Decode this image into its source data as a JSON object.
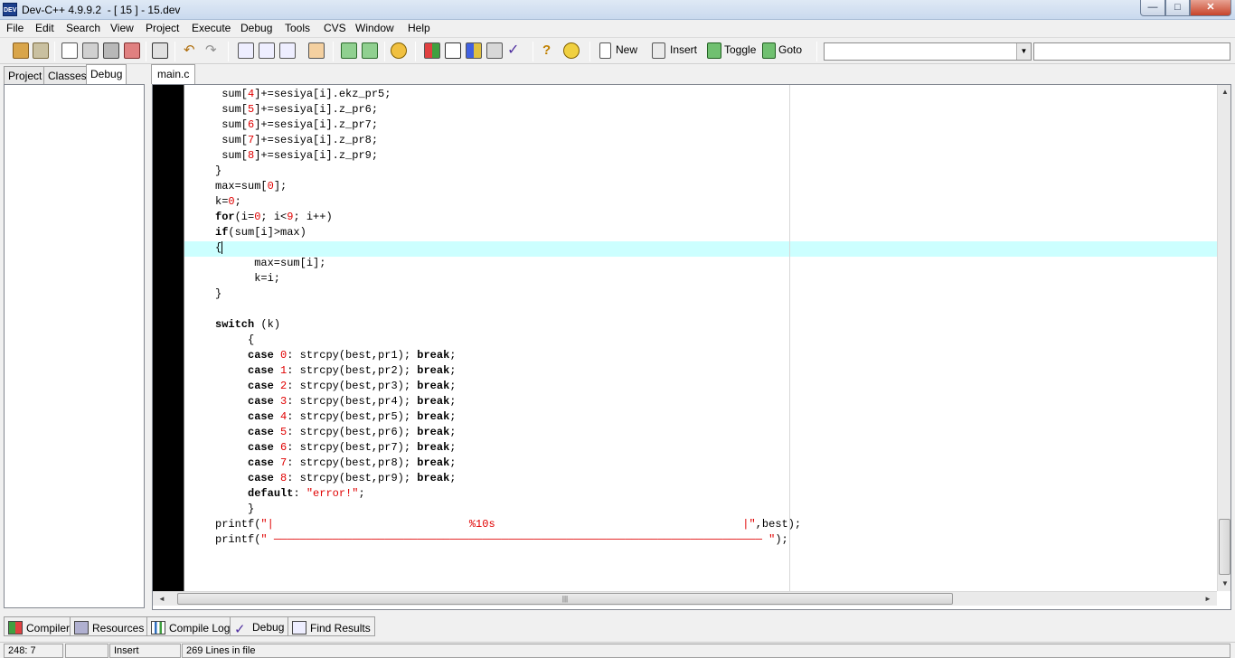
{
  "window": {
    "title": "Dev-C++ 4.9.9.2  - [ 15 ] - 15.dev",
    "app_icon_text": "DEV",
    "minimize": "—",
    "maximize": "□",
    "close": "✕"
  },
  "menu": {
    "file": "File",
    "edit": "Edit",
    "search": "Search",
    "view": "View",
    "project": "Project",
    "execute": "Execute",
    "debug": "Debug",
    "tools": "Tools",
    "cvs": "CVS",
    "window": "Window",
    "help": "Help"
  },
  "toolbar": {
    "new_label": "New",
    "insert_label": "Insert",
    "toggle_label": "Toggle",
    "goto_label": "Goto",
    "class_combo_value": "",
    "member_combo_value": ""
  },
  "left_tabs": {
    "project": "Project",
    "classes": "Classes",
    "debug": "Debug"
  },
  "editor": {
    "tab_name": "main.c",
    "lines": [
      " sum[4]+=sesiya[i].ekz_pr5;",
      " sum[5]+=sesiya[i].z_pr6;",
      " sum[6]+=sesiya[i].z_pr7;",
      " sum[7]+=sesiya[i].z_pr8;",
      " sum[8]+=sesiya[i].z_pr9;",
      "}",
      "max=sum[0];",
      "k=0;",
      "for(i=0; i<9; i++)",
      "if(sum[i]>max)",
      "{",
      "      max=sum[i];",
      "      k=i;",
      "}",
      "",
      "switch (k)",
      "     {",
      "     case 0: strcpy(best,pr1); break;",
      "     case 1: strcpy(best,pr2); break;",
      "     case 2: strcpy(best,pr3); break;",
      "     case 3: strcpy(best,pr4); break;",
      "     case 4: strcpy(best,pr5); break;",
      "     case 5: strcpy(best,pr6); break;",
      "     case 6: strcpy(best,pr7); break;",
      "     case 7: strcpy(best,pr8); break;",
      "     case 8: strcpy(best,pr9); break;",
      "     default: \"error!\";",
      "     }",
      "printf(\"|                              %10s                                      |\",best);",
      "printf(\" ─────────────────────────────────────────────────────────────────────────── \");"
    ],
    "scroll_left": "◄",
    "scroll_right": "►",
    "scroll_up": "▲",
    "scroll_down": "▼",
    "hthumb_grip": "|||"
  },
  "bottom_tabs": {
    "compiler": "Compiler",
    "resources": "Resources",
    "compile_log": "Compile Log",
    "debug": "Debug",
    "find_results": "Find Results"
  },
  "status": {
    "position": "248: 7",
    "modified": "",
    "mode": "Insert",
    "lines_info": "269 Lines in file"
  },
  "colors": {
    "current_line": "#ccffff",
    "gutter": "#000000",
    "number_string": "#e00000"
  }
}
